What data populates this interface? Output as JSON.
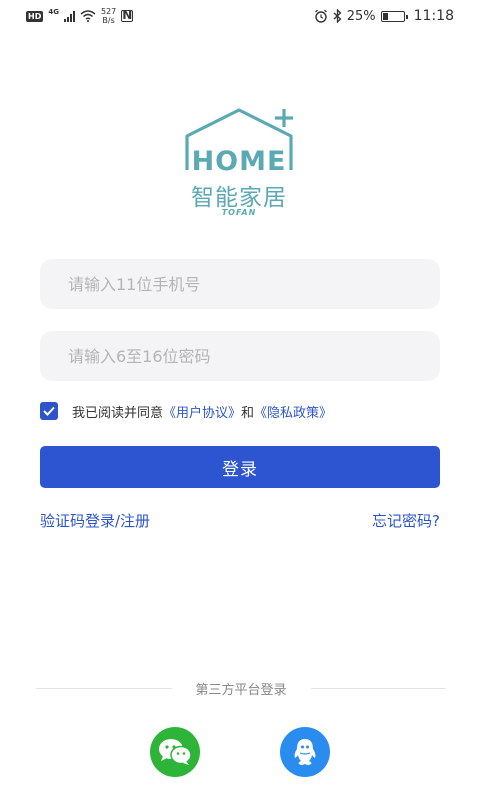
{
  "status_bar": {
    "hd": "HD",
    "net_type": "4G",
    "speed_value": "527",
    "speed_unit": "B/s",
    "nfc": "N",
    "battery_text": "25%",
    "battery_level": 0.25,
    "time": "11:18"
  },
  "logo": {
    "home_text": "HOME",
    "chinese_name": "智能家居",
    "brand": "TOFAN"
  },
  "form": {
    "phone_placeholder": "请输入11位手机号",
    "phone_value": "",
    "password_placeholder": "请输入6至16位密码",
    "password_value": "",
    "agree_checked": true,
    "agree_prefix": "我已阅读并同意",
    "user_agreement": "《用户协议》",
    "and_text": "和",
    "privacy_policy": "《隐私政策》",
    "login_label": "登录",
    "sms_login_label": "验证码登录/注册",
    "forgot_label": "忘记密码?"
  },
  "third_party": {
    "title": "第三方平台登录",
    "options": [
      {
        "name": "wechat-icon",
        "color": "#2fb43a"
      },
      {
        "name": "qq-icon",
        "color": "#2b8cf0"
      }
    ]
  },
  "colors": {
    "accent": "#2d55d1",
    "logo": "#5aa9b3",
    "input_bg": "#f4f4f6"
  }
}
